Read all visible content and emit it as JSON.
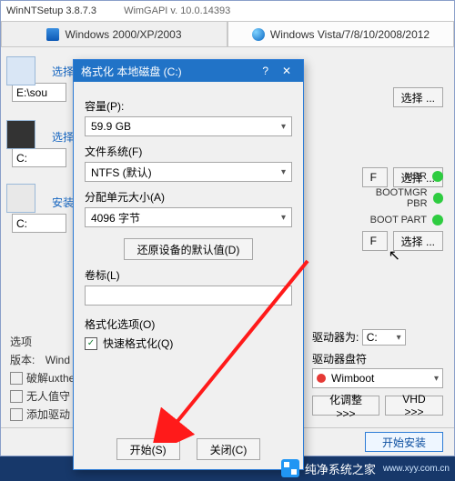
{
  "window": {
    "title": "WinNTSetup 3.8.7.3",
    "subtitle": "WimGAPI v. 10.0.14393"
  },
  "tabs": {
    "legacy": "Windows 2000/XP/2003",
    "modern": "Windows Vista/7/8/10/2008/2012"
  },
  "main": {
    "sec1_label": "选择包含Windows安装文件的文件夹",
    "sec1_value": "E:\\sou",
    "sec2_label": "选择",
    "sec2_value": "C:",
    "sec3_label": "安装",
    "sec3_value": "C:",
    "browse": "选择 ...",
    "f_label": "F",
    "options_label": "选项",
    "version_label": "版本:",
    "version_value": "Wind",
    "opt_crack": "破解uxthe",
    "opt_unattend": "无人值守",
    "opt_adddrv": "添加驱动"
  },
  "status": {
    "mbr": "MBR",
    "bootmgr": "BOOTMGR PBR",
    "bootpart": "BOOT PART"
  },
  "rightpanel": {
    "drive_as": "驱动器为:",
    "drive_val": "C:",
    "disk_as": "驱动器盘符",
    "wimboot": "Wimboot",
    "adjust": "化调整 >>>",
    "vhd": "VHD >>>",
    "start": "开始安装"
  },
  "modal": {
    "title": "格式化 本地磁盘 (C:)",
    "capacity_label": "容量(P):",
    "capacity_value": "59.9 GB",
    "fs_label": "文件系统(F)",
    "fs_value": "NTFS (默认)",
    "alloc_label": "分配单元大小(A)",
    "alloc_value": "4096 字节",
    "restore_btn": "还原设备的默认值(D)",
    "volume_label": "卷标(L)",
    "volume_value": "",
    "options_label": "格式化选项(O)",
    "quick_label": "快速格式化(Q)",
    "start_btn": "开始(S)",
    "close_btn": "关闭(C)"
  },
  "watermark": {
    "text": "纯净系统之家",
    "url": "www.xyy.com.cn"
  }
}
